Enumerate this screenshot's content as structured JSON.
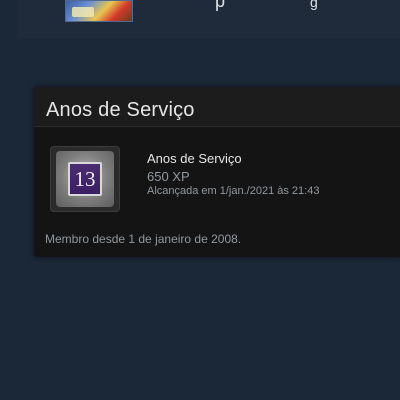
{
  "header": {
    "name_fragment_1": "p",
    "name_fragment_2": "g"
  },
  "badge_panel": {
    "title": "Anos de Serviço",
    "badge": {
      "level_number": "13",
      "name": "Anos de Serviço",
      "xp": "650 XP",
      "earned": "Alcançada em 1/jan./2021 às 21:43"
    },
    "member_since": "Membro desde 1 de janeiro de 2008."
  },
  "colors": {
    "page_background": "#1b2838",
    "panel_background": "#141414",
    "badge_plate": "#3a1f62"
  }
}
